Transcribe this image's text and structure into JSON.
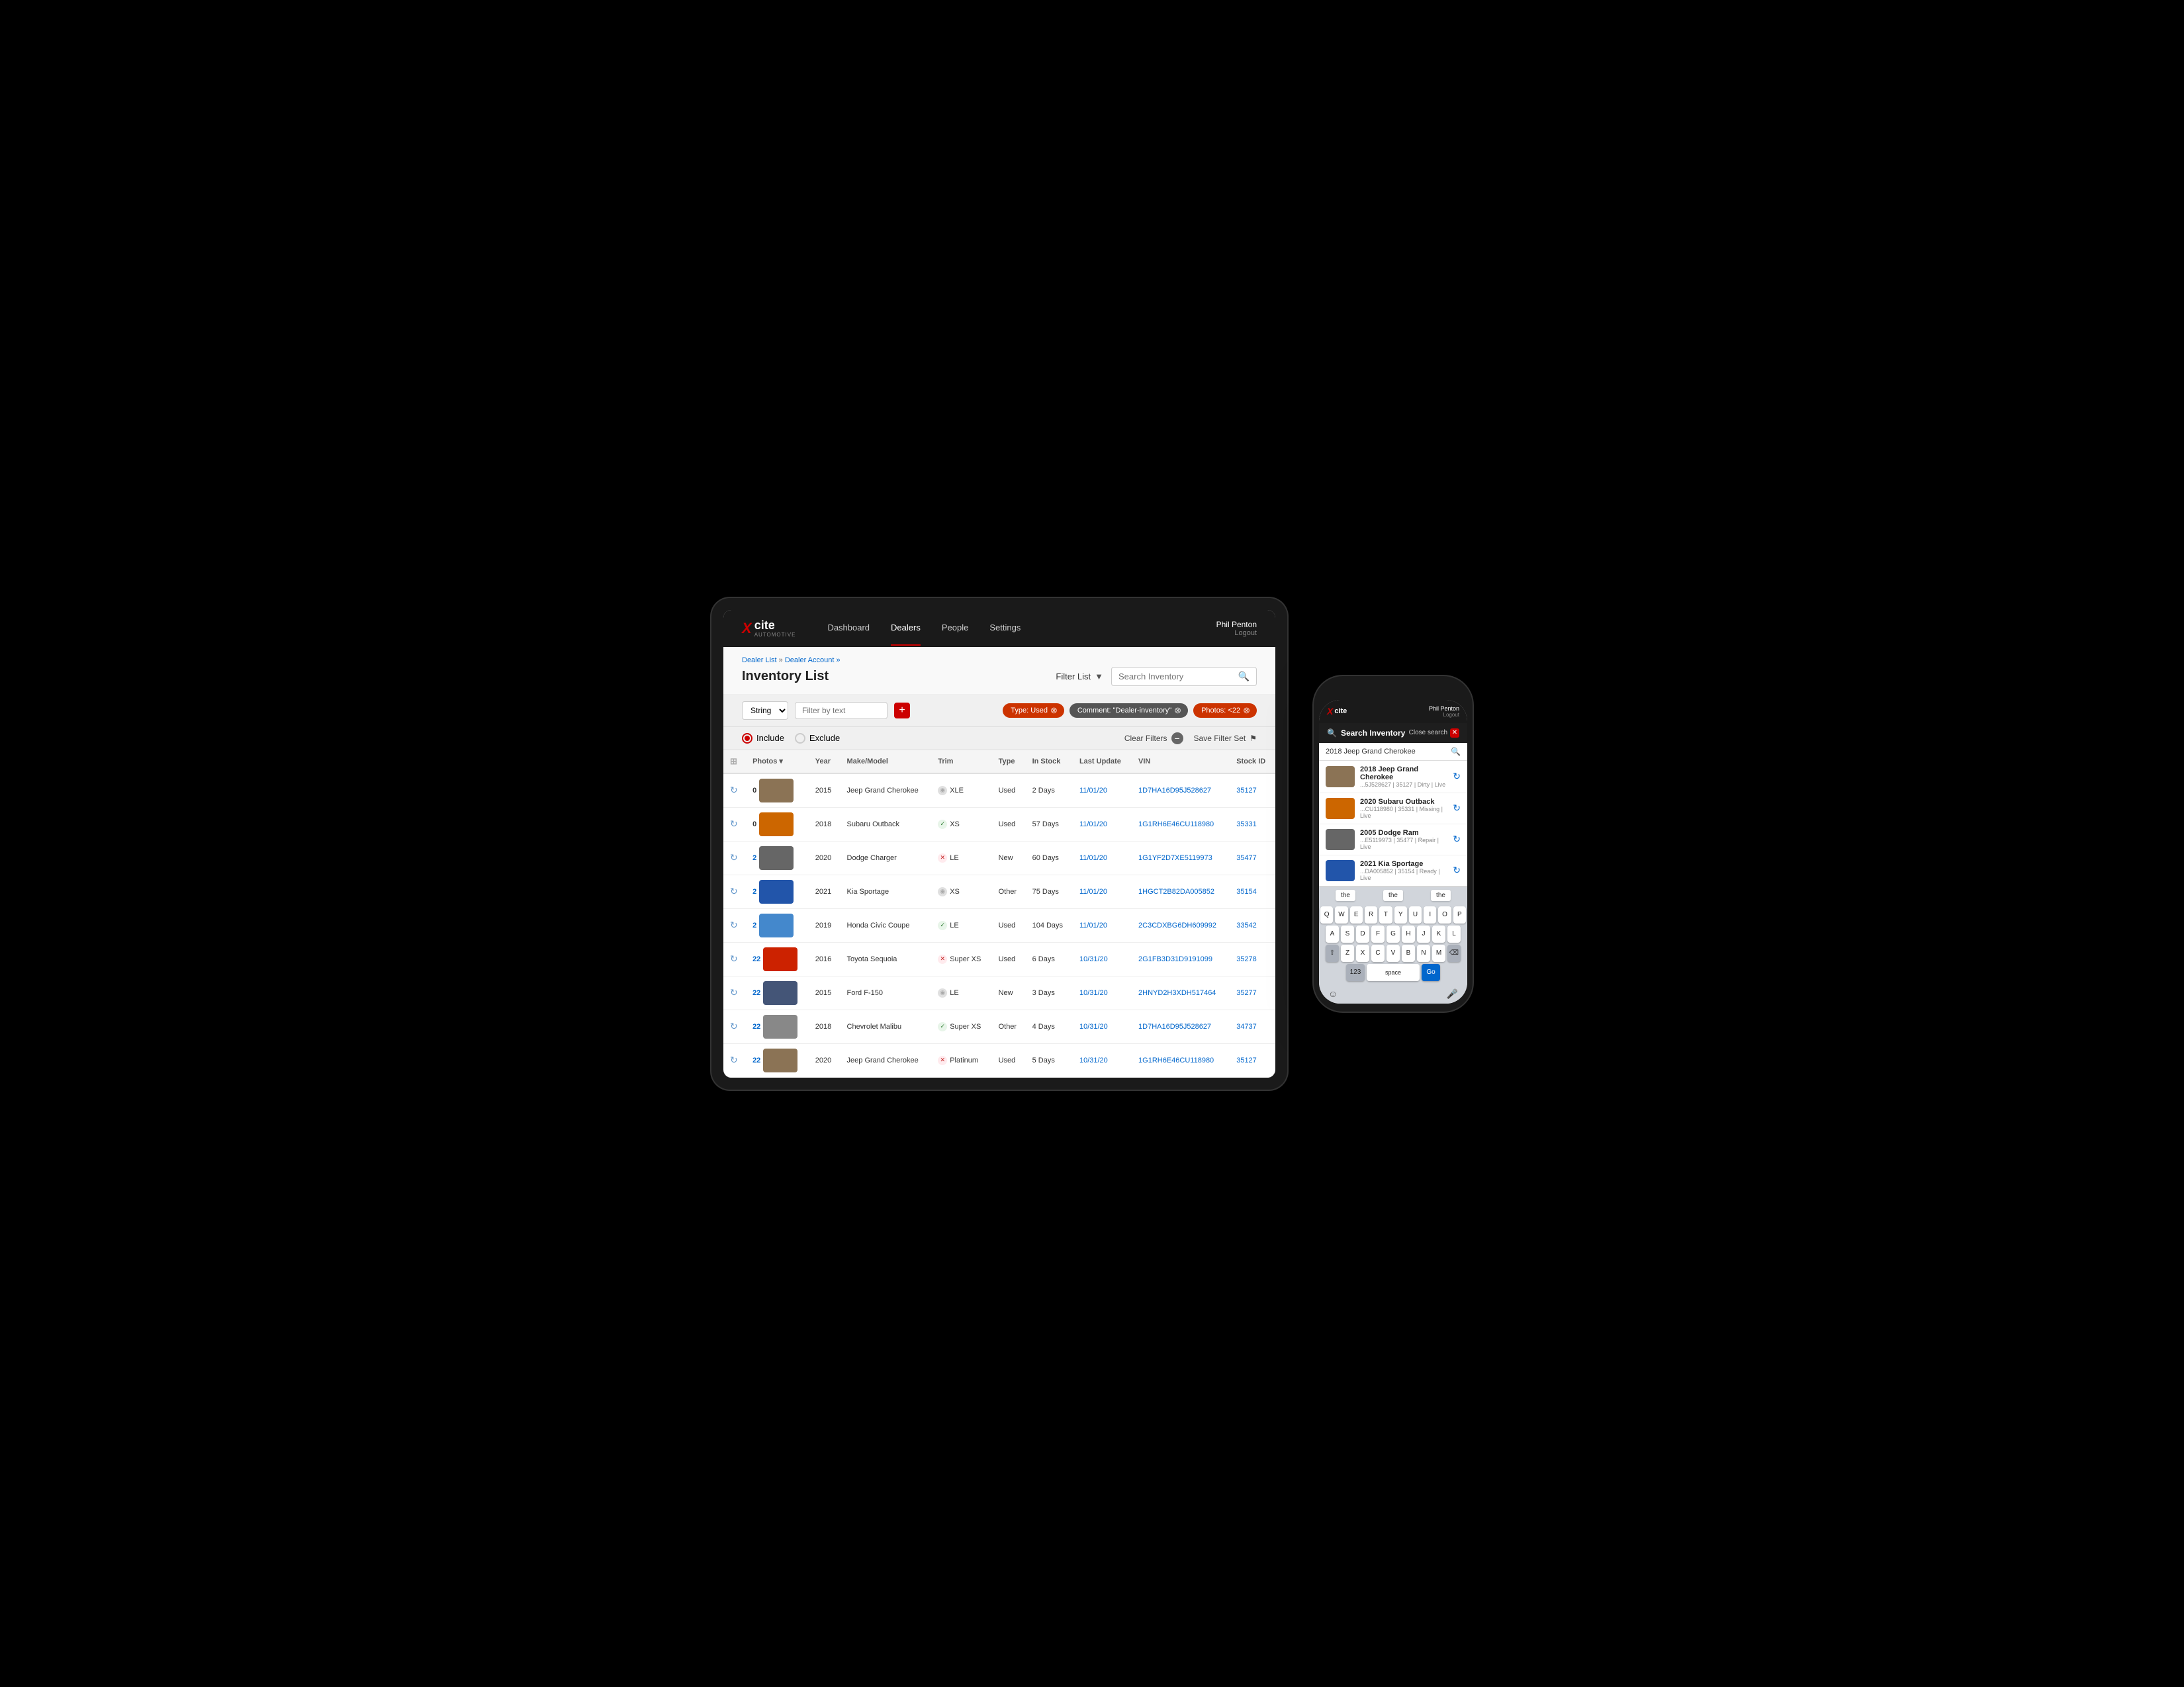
{
  "app": {
    "logo_x": "X",
    "logo_cite": "cite",
    "logo_sub": "AUTOMOTIVE"
  },
  "tablet": {
    "navbar": {
      "links": [
        "Dashboard",
        "Dealers",
        "People",
        "Settings"
      ],
      "active_link": "Dealers",
      "user_name": "Phil Penton",
      "logout_label": "Logout"
    },
    "breadcrumb": {
      "part1": "Dealer List",
      "separator": " » ",
      "part2": "Dealer Account »"
    },
    "page_title": "Inventory List",
    "filter_list_label": "Filter List",
    "search_placeholder": "Search Inventory",
    "filter_string_label": "String",
    "filter_text_placeholder": "Filter by text",
    "add_filter_label": "+",
    "filter_tags": [
      {
        "label": "Type: Used",
        "type": "red"
      },
      {
        "label": "Comment: \"Dealer-inventory\"",
        "type": "striked"
      },
      {
        "label": "Photos: <22",
        "type": "red"
      }
    ],
    "include_label": "Include",
    "exclude_label": "Exclude",
    "clear_filters_label": "Clear Filters",
    "save_filter_label": "Save Filter Set",
    "table": {
      "headers": [
        "",
        "Photos",
        "Year",
        "Make/Model",
        "Trim",
        "Type",
        "In Stock",
        "Last Update",
        "VIN",
        "Stock ID"
      ],
      "rows": [
        {
          "year": "2015",
          "make_model": "Jeep Grand Cherokee",
          "trim": "XLE",
          "trim_type": "grey",
          "type": "Used",
          "in_stock": "2 Days",
          "last_update": "11/01/20",
          "vin": "1D7HA16D95J528627",
          "stock_id": "35127",
          "photos": "0",
          "thumb": "thumb-jeep"
        },
        {
          "year": "2018",
          "make_model": "Subaru Outback",
          "trim": "XS",
          "trim_type": "green",
          "type": "Used",
          "in_stock": "57 Days",
          "last_update": "11/01/20",
          "vin": "1G1RH6E46CU118980",
          "stock_id": "35331",
          "photos": "0",
          "thumb": "thumb-subaru"
        },
        {
          "year": "2020",
          "make_model": "Dodge Charger",
          "trim": "LE",
          "trim_type": "red",
          "type": "New",
          "in_stock": "60 Days",
          "last_update": "11/01/20",
          "vin": "1G1YF2D7XE5119973",
          "stock_id": "35477",
          "photos": "2",
          "thumb": "thumb-dodge"
        },
        {
          "year": "2021",
          "make_model": "Kia Sportage",
          "trim": "XS",
          "trim_type": "grey",
          "type": "Other",
          "in_stock": "75 Days",
          "last_update": "11/01/20",
          "vin": "1HGCT2B82DA005852",
          "stock_id": "35154",
          "photos": "2",
          "thumb": "thumb-kia"
        },
        {
          "year": "2019",
          "make_model": "Honda Civic Coupe",
          "trim": "LE",
          "trim_type": "green",
          "type": "Used",
          "in_stock": "104 Days",
          "last_update": "11/01/20",
          "vin": "2C3CDXBG6DH609992",
          "stock_id": "33542",
          "photos": "2",
          "thumb": "thumb-honda"
        },
        {
          "year": "2016",
          "make_model": "Toyota Sequoia",
          "trim": "Super XS",
          "trim_type": "red",
          "type": "Used",
          "in_stock": "6 Days",
          "last_update": "10/31/20",
          "vin": "2G1FB3D31D9191099",
          "stock_id": "35278",
          "photos": "22",
          "thumb": "thumb-toyota"
        },
        {
          "year": "2015",
          "make_model": "Ford F-150",
          "trim": "LE",
          "trim_type": "grey",
          "type": "New",
          "in_stock": "3 Days",
          "last_update": "10/31/20",
          "vin": "2HNYD2H3XDH517464",
          "stock_id": "35277",
          "photos": "22",
          "thumb": "thumb-ford"
        },
        {
          "year": "2018",
          "make_model": "Chevrolet Malibu",
          "trim": "Super XS",
          "trim_type": "green",
          "type": "Other",
          "in_stock": "4 Days",
          "last_update": "10/31/20",
          "vin": "1D7HA16D95J528627",
          "stock_id": "34737",
          "photos": "22",
          "thumb": "thumb-chevy"
        },
        {
          "year": "2020",
          "make_model": "Jeep Grand Cherokee",
          "trim": "Platinum",
          "trim_type": "red",
          "type": "Used",
          "in_stock": "5 Days",
          "last_update": "10/31/20",
          "vin": "1G1RH6E46CU118980",
          "stock_id": "35127",
          "photos": "22",
          "thumb": "thumb-jeep"
        }
      ]
    }
  },
  "phone": {
    "navbar": {
      "user_name": "Phil Penton",
      "logout_label": "Logout"
    },
    "search_title": "Search Inventory",
    "close_search_label": "Close search",
    "search_value": "2018 Jeep Grand Cherokee",
    "results": [
      {
        "name": "2018 Jeep Grand Cherokee",
        "meta": "...5J528627  |  35127  |  Dirty | Live",
        "thumb": "thumb-jeep"
      },
      {
        "name": "2020 Subaru Outback",
        "meta": "...CU118980  |  35331  |  Missing | Live",
        "thumb": "thumb-subaru"
      },
      {
        "name": "2005 Dodge Ram",
        "meta": "...E5119973  |  35477  |  Repair | Live",
        "thumb": "thumb-dodge"
      },
      {
        "name": "2021 Kia Sportage",
        "meta": "...DA005852  |  35154  |  Ready | Live",
        "thumb": "thumb-kia"
      }
    ],
    "keyboard_suggest": [
      "the",
      "the",
      "the"
    ],
    "keyboard_rows": [
      [
        "Q",
        "W",
        "E",
        "R",
        "T",
        "Y",
        "U",
        "I",
        "O",
        "P"
      ],
      [
        "A",
        "S",
        "D",
        "F",
        "G",
        "H",
        "J",
        "K",
        "L"
      ],
      [
        "⇧",
        "Z",
        "X",
        "C",
        "V",
        "B",
        "N",
        "M",
        "⌫"
      ],
      [
        "123",
        "space",
        "Go"
      ]
    ]
  }
}
